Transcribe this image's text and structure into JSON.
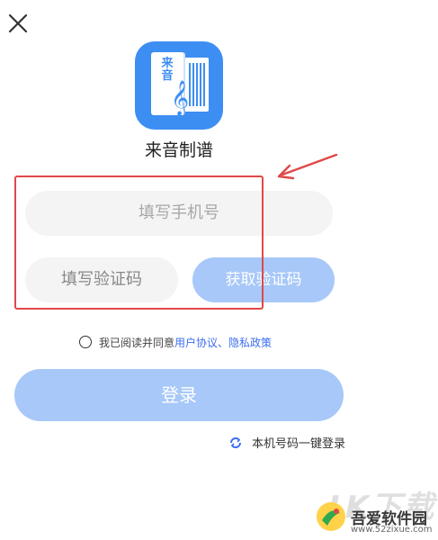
{
  "app": {
    "name": "来音制谱",
    "logo_text": "来音",
    "brand_color": "#3d8ef2"
  },
  "header": {
    "close_icon": "close-icon"
  },
  "form": {
    "phone_placeholder": "填写手机号",
    "code_placeholder": "填写验证码",
    "get_code_label": "获取验证码"
  },
  "agreement": {
    "prefix": "我已阅读并同意",
    "user_agreement": "用户协议",
    "separator": "、",
    "privacy_policy": "隐私政策"
  },
  "login": {
    "button_label": "登录",
    "one_key_label": "本机号码一键登录",
    "button_color": "#a7c8f8"
  },
  "annotation": {
    "highlight_color": "#e04848"
  },
  "watermark": {
    "mark": "⅄K下载",
    "site_name": "吾爱软件园",
    "url": "www.52zixue.com"
  }
}
